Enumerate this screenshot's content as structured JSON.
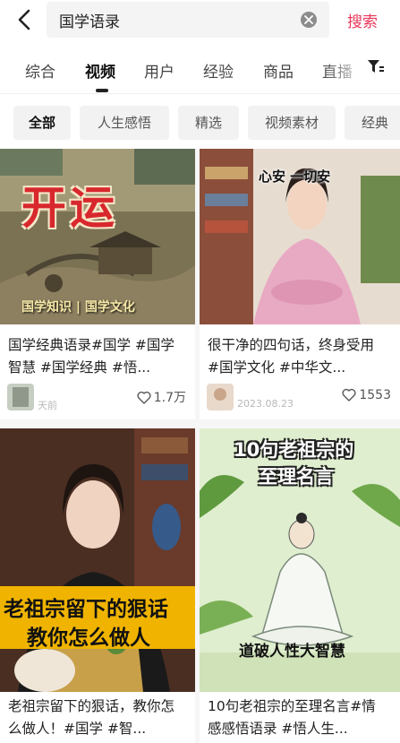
{
  "search": {
    "query": "国学语录",
    "submit_label": "搜索"
  },
  "tabs": [
    {
      "label": "综合",
      "active": false
    },
    {
      "label": "视频",
      "active": true
    },
    {
      "label": "用户",
      "active": false
    },
    {
      "label": "经验",
      "active": false
    },
    {
      "label": "商品",
      "active": false
    },
    {
      "label": "直播",
      "active": false
    }
  ],
  "chips": [
    {
      "label": "全部",
      "active": true
    },
    {
      "label": "人生感悟",
      "active": false
    },
    {
      "label": "精选",
      "active": false
    },
    {
      "label": "视频素材",
      "active": false
    },
    {
      "label": "经典",
      "active": false
    }
  ],
  "icons": {
    "back": "back-arrow-icon",
    "clear": "clear-icon",
    "filter": "filter-icon",
    "like": "heart-icon"
  },
  "colors": {
    "accent": "#e8375a",
    "cover1_title": "#d8282d",
    "cover3_banner": "#f0b400",
    "cover4_bg": "#dfeece"
  },
  "videos": [
    {
      "title": "国学经典语录#国学 #国学智慧 #国学经典 #悟...",
      "cover_text": "开运",
      "cover_caption": "国学知识 | 国学文化",
      "meta_time": "天前",
      "likes": "1.7万"
    },
    {
      "title": "很干净的四句话，终身受用#国学文化 #中华文...",
      "cover_text": "心安 一切安",
      "meta_time": "2023.08.23",
      "likes": "1553"
    },
    {
      "title": "老祖宗留下的狠话，教你怎么做人！#国学 #智...",
      "cover_line1": "老祖宗留下的狠话",
      "cover_line2": "教你怎么做人"
    },
    {
      "title": "10句老祖宗的至理名言#情感感悟语录 #悟人生...",
      "cover_line1": "10句老祖宗的",
      "cover_line2": "至理名言",
      "cover_footer": "道破人性大智慧"
    }
  ]
}
